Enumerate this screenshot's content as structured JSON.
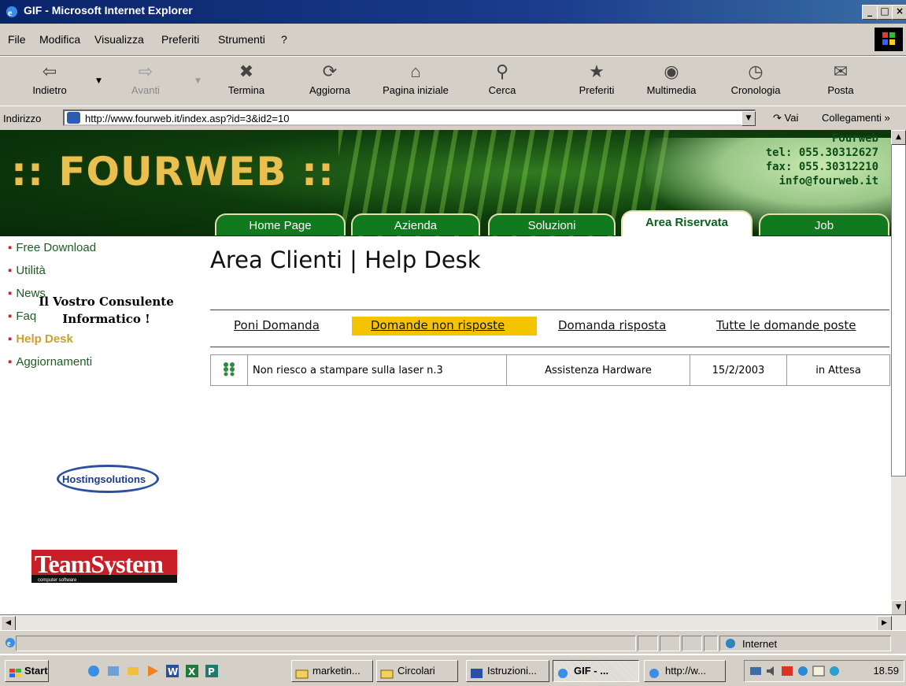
{
  "window": {
    "title": "GIF - Microsoft Internet Explorer",
    "controls": [
      "_",
      "□",
      "×"
    ]
  },
  "menu": [
    "File",
    "Modifica",
    "Visualizza",
    "Preferiti",
    "Strumenti",
    "?"
  ],
  "toolbar": {
    "back": "Indietro",
    "forward": "Avanti",
    "stop": "Termina",
    "refresh": "Aggiorna",
    "home": "Pagina iniziale",
    "search": "Cerca",
    "favorites": "Preferiti",
    "media": "Multimedia",
    "history": "Cronologia",
    "mail": "Posta"
  },
  "address": {
    "label": "Indirizzo",
    "url": "http://www.fourweb.it/index.asp?id=3&id2=10",
    "go": "Vai",
    "links": "Collegamenti"
  },
  "site": {
    "logo": ":: FOURWEB ::",
    "contact": [
      "Fourweb",
      "tel: 055.30312627",
      "fax: 055.30312210",
      "info@fourweb.it"
    ],
    "tabs": [
      "Home Page",
      "Azienda",
      "Soluzioni",
      "Area Riservata",
      "Job"
    ],
    "active_tab": "Area Riservata"
  },
  "sidebar": {
    "items": [
      "Free Download",
      "Utilità",
      "News",
      "Faq",
      "Help Desk",
      "Aggiornamenti"
    ],
    "active": "Help Desk",
    "tagline": [
      "Il Vostro Consulente",
      "Informatico !"
    ],
    "hosting_logo": "Hostingsolutions",
    "teamsystem_logo": "TeamSystem",
    "teamsystem_sub": "computer software"
  },
  "main": {
    "title": "Area Clienti | Help Desk",
    "tabs": [
      "Poni Domanda",
      "Domande non risposte",
      "Domanda risposta",
      "Tutte le domande poste"
    ],
    "active_tab": "Domande non risposte",
    "rows": [
      {
        "icon": "dots-icon",
        "question": "Non riesco a stampare sulla laser n.3",
        "category": "Assistenza Hardware",
        "date": "15/2/2003",
        "status": "in Attesa"
      }
    ]
  },
  "status": {
    "zone": "Internet"
  },
  "taskbar": {
    "start": "Start",
    "tasks": [
      "marketin...",
      "Circolari",
      "Istruzioni...",
      "GIF - ...",
      "http://w..."
    ],
    "active_task": "GIF - ...",
    "clock": "18.59"
  },
  "colors": {
    "accent": "#f5c400",
    "brand_green": "#127a1e",
    "title_bar": "#0a246a"
  }
}
